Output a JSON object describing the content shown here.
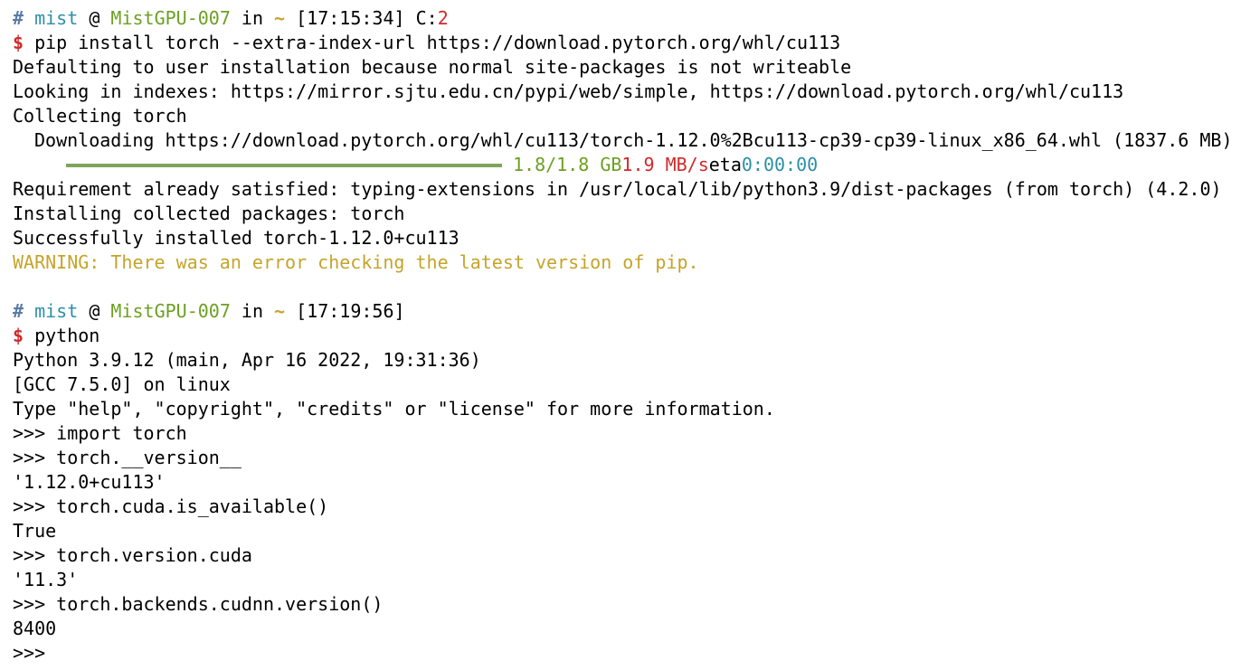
{
  "prompts": [
    {
      "hash": "#",
      "user": "mist",
      "at": "@",
      "host": "MistGPU-007",
      "in": "in",
      "dir": "~",
      "time": "[17:15:34]",
      "code_label": "C:",
      "code": "2",
      "dollar": "$",
      "command": "pip install torch --extra-index-url https://download.pytorch.org/whl/cu113"
    },
    {
      "hash": "#",
      "user": "mist",
      "at": "@",
      "host": "MistGPU-007",
      "in": "in",
      "dir": "~",
      "time": "[17:19:56]",
      "dollar": "$",
      "command": "python"
    }
  ],
  "pip_output": {
    "lines": [
      "Defaulting to user installation because normal site-packages is not writeable",
      "Looking in indexes: https://mirror.sjtu.edu.cn/pypi/web/simple, https://download.pytorch.org/whl/cu113",
      "Collecting torch"
    ],
    "downloading": "Downloading https://download.pytorch.org/whl/cu113/torch-1.12.0%2Bcu113-cp39-cp39-linux_x86_64.whl (1837.6 MB)",
    "progress": {
      "fraction": 1.0,
      "size": "1.8/1.8 GB",
      "speed": "1.9 MB/s",
      "eta_label": "eta",
      "eta": "0:00:00",
      "fill_color": "#7fa55a"
    },
    "lines_after": [
      "Requirement already satisfied: typing-extensions in /usr/local/lib/python3.9/dist-packages (from torch) (4.2.0)",
      "Installing collected packages: torch",
      "Successfully installed torch-1.12.0+cu113"
    ],
    "warning": "WARNING: There was an error checking the latest version of pip."
  },
  "python_session": {
    "lines": [
      "Python 3.9.12 (main, Apr 16 2022, 19:31:36)",
      "[GCC 7.5.0] on linux",
      "Type \"help\", \"copyright\", \"credits\" or \"license\" for more information.",
      ">>> import torch",
      ">>> torch.__version__",
      "'1.12.0+cu113'",
      ">>> torch.cuda.is_available()",
      "True",
      ">>> torch.version.cuda",
      "'11.3'",
      ">>> torch.backends.cudnn.version()",
      "8400",
      ">>>"
    ]
  },
  "colors": {
    "hash": "#5a7ca6",
    "user": "#2c8fa8",
    "host": "#6ca022",
    "tilde": "#c9a227",
    "dollar": "#cf2a2a",
    "warning": "#c4a42b"
  }
}
